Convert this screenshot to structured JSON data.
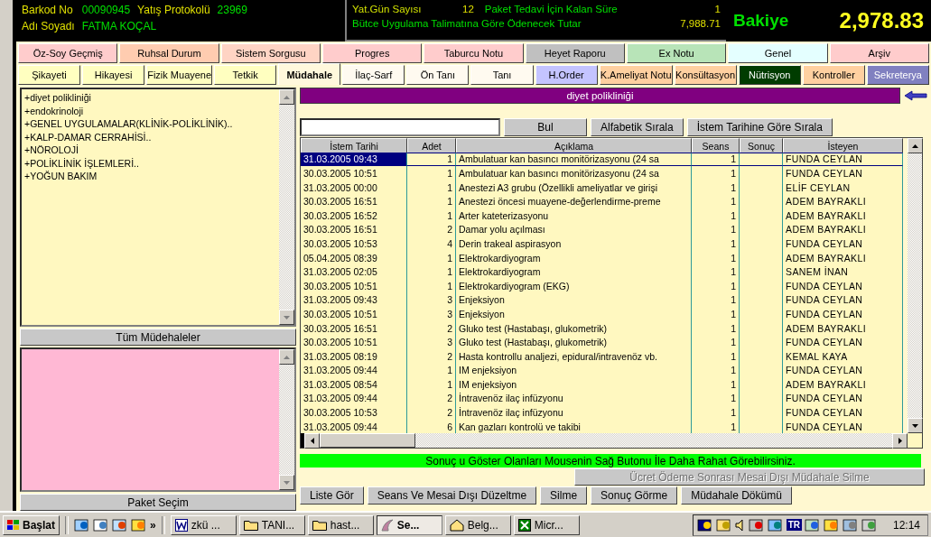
{
  "header": {
    "barcode_label": "Barkod No",
    "barcode": "00090945",
    "protocol_label": "Yatış Protokolü",
    "protocol": "23969",
    "name_label": "Adı Soyadı",
    "name": "FATMA KOÇAL",
    "days_label": "Yat.Gün Sayısı",
    "days": "12",
    "remaining_label": "Paket Tedavi İçin Kalan Süre",
    "remaining": "1",
    "amount_label": "Bütce Uygulama Talimatına Göre  Ödenecek Tutar",
    "amount": "7,988.71",
    "balance_label": "Bakiye",
    "balance": "2,978.83"
  },
  "tabs_top": [
    {
      "label": "Öz-Soy Geçmiş",
      "color": "#ffcccc",
      "selected": false
    },
    {
      "label": "Ruhsal Durum",
      "color": "#ffccb0",
      "selected": false
    },
    {
      "label": "Sistem Sorgusu",
      "color": "#ffd4c4",
      "selected": false
    },
    {
      "label": "Progres",
      "color": "#ffcccc",
      "selected": false
    },
    {
      "label": "Taburcu Notu",
      "color": "#ffcccc",
      "selected": false
    },
    {
      "label": "Heyet Raporu",
      "color": "#c0c0c0",
      "selected": false
    },
    {
      "label": "Ex Notu",
      "color": "#b8e4b8",
      "selected": false
    },
    {
      "label": "Genel",
      "color": "#e4ffff",
      "selected": false
    },
    {
      "label": "Arşiv",
      "color": "#ffcccc",
      "selected": false
    }
  ],
  "tabs_bottom": [
    {
      "label": "Şikayeti",
      "color": "#ffffc0",
      "selected": false
    },
    {
      "label": "Hikayesi",
      "color": "#ffffc0",
      "selected": false
    },
    {
      "label": "Fizik Muayene",
      "color": "#ffffc0",
      "selected": false
    },
    {
      "label": "Tetkik",
      "color": "#ffffc0",
      "selected": false
    },
    {
      "label": "Müdahale",
      "color": "#fff8dc",
      "selected": true
    },
    {
      "label": "İlaç-Sarf",
      "color": "#fffaf0",
      "selected": false
    },
    {
      "label": "Ön Tanı",
      "color": "#fffaf0",
      "selected": false
    },
    {
      "label": "Tanı",
      "color": "#fffaf0",
      "selected": false
    },
    {
      "label": "H.Order",
      "color": "#c4c4ff",
      "selected": false
    },
    {
      "label": "K.Ameliyat Notu",
      "color": "#ffd0a0",
      "selected": false
    },
    {
      "label": "Konsültasyon",
      "color": "#ffd0a0",
      "selected": false
    },
    {
      "label": "Nütrisyon",
      "color": "#003c00",
      "selected": false
    },
    {
      "label": "Kontroller",
      "color": "#ffd0a0",
      "selected": false
    },
    {
      "label": "Sekreterya",
      "color": "#8080c0",
      "selected": false
    }
  ],
  "category_list": [
    "+diyet polikliniği",
    "+endokrinoloji",
    "+GENEL UYGULAMALAR(KLİNİK-POLİKLİNİK)..",
    "+KALP-DAMAR CERRAHİSİ..",
    "+NÖROLOJİ",
    "+POLİKLİNİK İŞLEMLERİ..",
    "+YOĞUN BAKIM"
  ],
  "all_button": "Tüm Müdehaleler",
  "package_button": "Paket Seçim",
  "section_title": "diyet polikliniği",
  "search_buttons": [
    "Bul",
    "Alfabetik Sırala",
    "İstem Tarihine Göre Sırala"
  ],
  "table": {
    "columns": [
      "İstem Tarihi",
      "Adet",
      "Açıklama",
      "Seans",
      "Sonuç",
      "İsteyen"
    ],
    "rows": [
      {
        "date": "31.03.2005 09:43",
        "count": "1",
        "description": "Ambulatuar kan basıncı monitörizasyonu (24 sa",
        "sessions": "1",
        "requester": "FUNDA CEYLAN",
        "selected": true
      },
      {
        "date": "30.03.2005 10:51",
        "count": "1",
        "description": "Ambulatuar kan basıncı monitörizasyonu (24 sa",
        "sessions": "1",
        "requester": "FUNDA CEYLAN",
        "selected": false
      },
      {
        "date": "31.03.2005 00:00",
        "count": "1",
        "description": "Anestezi A3 grubu (Özellikli ameliyatlar ve girişi",
        "sessions": "1",
        "requester": "ELİF CEYLAN",
        "selected": false
      },
      {
        "date": "30.03.2005 16:51",
        "count": "1",
        "description": "Anestezi öncesi muayene-değerlendirme-preme",
        "sessions": "1",
        "requester": "ADEM BAYRAKLI",
        "selected": false
      },
      {
        "date": "30.03.2005 16:52",
        "count": "1",
        "description": "Arter kateterizasyonu",
        "sessions": "1",
        "requester": "ADEM BAYRAKLI",
        "selected": false
      },
      {
        "date": "30.03.2005 16:51",
        "count": "2",
        "description": "Damar yolu açılması",
        "sessions": "1",
        "requester": "ADEM BAYRAKLI",
        "selected": false
      },
      {
        "date": "30.03.2005 10:53",
        "count": "4",
        "description": "Derin trakeal aspirasyon",
        "sessions": "1",
        "requester": "FUNDA CEYLAN",
        "selected": false
      },
      {
        "date": "05.04.2005 08:39",
        "count": "1",
        "description": "Elektrokardiyogram",
        "sessions": "1",
        "requester": "ADEM BAYRAKLI",
        "selected": false
      },
      {
        "date": "31.03.2005 02:05",
        "count": "1",
        "description": "Elektrokardiyogram",
        "sessions": "1",
        "requester": "SANEM İNAN",
        "selected": false
      },
      {
        "date": "30.03.2005 10:51",
        "count": "1",
        "description": "Elektrokardiyogram (EKG)",
        "sessions": "1",
        "requester": "FUNDA CEYLAN",
        "selected": false
      },
      {
        "date": "31.03.2005 09:43",
        "count": "3",
        "description": "Enjeksiyon",
        "sessions": "1",
        "requester": "FUNDA CEYLAN",
        "selected": false
      },
      {
        "date": "30.03.2005 10:51",
        "count": "3",
        "description": "Enjeksiyon",
        "sessions": "1",
        "requester": "FUNDA CEYLAN",
        "selected": false
      },
      {
        "date": "30.03.2005 16:51",
        "count": "2",
        "description": "Gluko test (Hastabaşı, glukometrik)",
        "sessions": "1",
        "requester": "ADEM BAYRAKLI",
        "selected": false
      },
      {
        "date": "30.03.2005 10:51",
        "count": "3",
        "description": "Gluko test (Hastabaşı, glukometrik)",
        "sessions": "1",
        "requester": "FUNDA CEYLAN",
        "selected": false
      },
      {
        "date": "31.03.2005 08:19",
        "count": "2",
        "description": "Hasta kontrollu analjezi, epidural/intravenöz vb.",
        "sessions": "1",
        "requester": "KEMAL KAYA",
        "selected": false
      },
      {
        "date": "31.03.2005 09:44",
        "count": "1",
        "description": "IM enjeksiyon",
        "sessions": "1",
        "requester": "FUNDA CEYLAN",
        "selected": false
      },
      {
        "date": "31.03.2005 08:54",
        "count": "1",
        "description": "IM enjeksiyon",
        "sessions": "1",
        "requester": "ADEM BAYRAKLI",
        "selected": false
      },
      {
        "date": "31.03.2005 09:44",
        "count": "2",
        "description": "İntravenöz ilaç infüzyonu",
        "sessions": "1",
        "requester": "FUNDA CEYLAN",
        "selected": false
      },
      {
        "date": "30.03.2005 10:53",
        "count": "2",
        "description": "İntravenöz ilaç infüzyonu",
        "sessions": "1",
        "requester": "FUNDA CEYLAN",
        "selected": false
      },
      {
        "date": "31.03.2005 09:44",
        "count": "6",
        "description": "Kan gazları kontrolü ve takibi",
        "sessions": "1",
        "requester": "FUNDA CEYLAN",
        "selected": false
      }
    ]
  },
  "hint": "Sonuç u Göster Olanları Mousenin Sağ Butonu İle Daha Rahat Görebilirsiniz.",
  "delete_after_payment": {
    "label": "Ücret Ödeme Sonrası  Mesai Dışı Müdahale Silme",
    "disabled": true
  },
  "actions": [
    "Liste Gör",
    "Seans Ve Mesai Dışı Düzeltme",
    "Silme",
    "Sonuç Görme",
    "Müdahale Dökümü"
  ],
  "taskbar": {
    "start": "Başlat",
    "more": "»",
    "tasks": [
      {
        "label": "zkü ...",
        "kind": "word",
        "selected": false
      },
      {
        "label": "TANI...",
        "kind": "folder",
        "selected": false
      },
      {
        "label": "hast...",
        "kind": "folder",
        "selected": false
      },
      {
        "label": "Se...",
        "kind": "app",
        "selected": true
      },
      {
        "label": "Belg...",
        "kind": "home",
        "selected": false
      },
      {
        "label": "Micr...",
        "kind": "excel",
        "selected": false
      }
    ],
    "language": "TR",
    "clock": "12:14"
  }
}
